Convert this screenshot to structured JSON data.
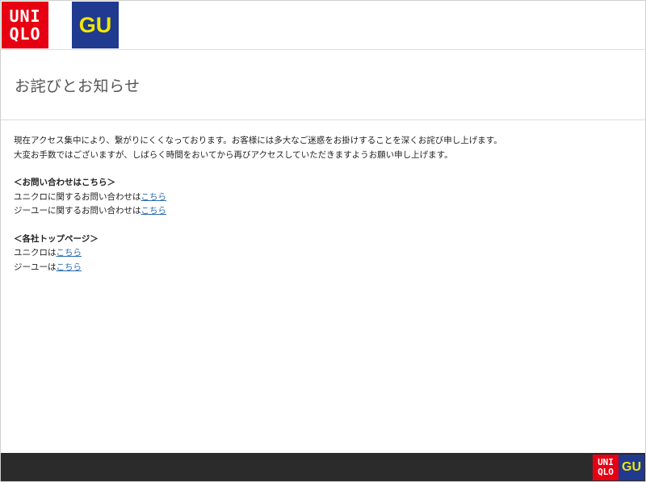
{
  "header": {
    "uniqlo_logo_line1": "UNI",
    "uniqlo_logo_line2": "QLO",
    "gu_logo": "GU"
  },
  "page_title": "お詫びとお知らせ",
  "message": {
    "line1": "現在アクセス集中により、繋がりにくくなっております。お客様には多大なご迷惑をお掛けすることを深くお詫び申し上げます。",
    "line2": "大変お手数ではございますが、しばらく時間をおいてから再びアクセスしていただきますようお願い申し上げます。"
  },
  "contact": {
    "heading": "＜お問い合わせはこちら＞",
    "uniqlo_text": "ユニクロに関するお問い合わせは",
    "uniqlo_link": "こちら",
    "gu_text": "ジーユーに関するお問い合わせは",
    "gu_link": "こちら"
  },
  "top_pages": {
    "heading": "＜各社トップページ＞",
    "uniqlo_text": "ユニクロは",
    "uniqlo_link": "こちら",
    "gu_text": "ジーユーは",
    "gu_link": "こちら"
  },
  "footer": {
    "uniqlo_logo_line1": "UNI",
    "uniqlo_logo_line2": "QLO",
    "gu_logo": "GU"
  },
  "colors": {
    "uniqlo_red": "#e60012",
    "gu_navy": "#1f3a8f",
    "gu_yellow": "#f2e600",
    "link": "#2a6db0",
    "footer_bg": "#2b2b2b"
  }
}
